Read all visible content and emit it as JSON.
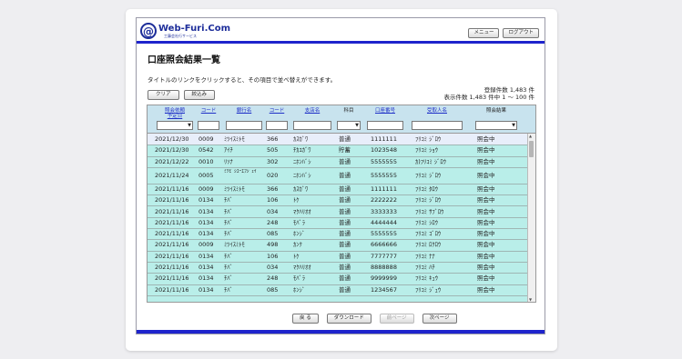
{
  "brand": {
    "at": "@",
    "name": "Web-Furi.Com",
    "tagline": "工藤会社行サービス"
  },
  "header": {
    "menu_label": "メニュー",
    "logout_label": "ログアウト"
  },
  "page_title": "口座照会結果一覧",
  "instruction": "タイトルのリンクをクリックすると、その項目で並べ替えができます。",
  "buttons": {
    "clear": "クリア",
    "filter": "絞込み"
  },
  "counts": {
    "registered": "登録件数  1,483 件",
    "displayed": "表示件数  1,483 件中 1 〜 100 件"
  },
  "columns": {
    "date_l1": "照会依頼",
    "date_l2": "予定日",
    "code1": "コード",
    "bank": "銀行名",
    "code2": "コード",
    "branch": "支店名",
    "type": "科目",
    "account": "口座番号",
    "name": "受取人名",
    "result": "照会結果"
  },
  "rows": [
    {
      "date": "2021/12/30",
      "bank_code": "0009",
      "bank": "ﾐﾂｲｽﾐﾄﾓ",
      "branch_code": "366",
      "branch": "ｶｽｶﾞﾜ",
      "type": "普通",
      "account": "1111111",
      "name": "ﾌﾘｺﾐ ｼﾞﾛｳ",
      "result": "照会中"
    },
    {
      "date": "2021/12/30",
      "bank_code": "0542",
      "bank": "ｱｲﾁ",
      "branch_code": "505",
      "branch": "ﾁｶﾕｶﾞﾜ",
      "type": "貯蓄",
      "account": "1023548",
      "name": "ﾌﾘｺﾐ ｼｮｳ",
      "result": "照会中"
    },
    {
      "date": "2021/12/22",
      "bank_code": "0010",
      "bank": "ﾘｿﾅ",
      "branch_code": "302",
      "branch": "ﾆﾎﾝﾊﾞｼ",
      "type": "普通",
      "account": "5555555",
      "name": "ｶ)ﾌﾘｺﾐ ｼﾞﾛｳ",
      "result": "照会中"
    },
    {
      "date": "2021/11/24",
      "bank_code": "0005",
      "bank": "ﾐﾂﾋﾞｼﾕｰｴﾌｼﾞｪｲ",
      "branch_code": "020",
      "branch": "ﾆﾎﾝﾊﾞｼ",
      "type": "普通",
      "account": "5555555",
      "name": "ﾌﾘｺﾐ ｼﾞﾛｳ",
      "result": "照会中"
    },
    {
      "date": "2021/11/16",
      "bank_code": "0009",
      "bank": "ﾐﾂｲｽﾐﾄﾓ",
      "branch_code": "366",
      "branch": "ｶｽｶﾞﾜ",
      "type": "普通",
      "account": "1111111",
      "name": "ﾌﾘｺﾐ ﾀﾛｳ",
      "result": "照会中"
    },
    {
      "date": "2021/11/16",
      "bank_code": "0134",
      "bank": "ﾁﾊﾞ",
      "branch_code": "106",
      "branch": "ﾄｹ",
      "type": "普通",
      "account": "2222222",
      "name": "ﾌﾘｺﾐ ｼﾞﾛｳ",
      "result": "照会中"
    },
    {
      "date": "2021/11/16",
      "bank_code": "0134",
      "bank": "ﾁﾊﾞ",
      "branch_code": "034",
      "branch": "ﾏｸﾊﾘｵｵ",
      "type": "普通",
      "account": "3333333",
      "name": "ﾌﾘｺﾐ ｻﾌﾞﾛｳ",
      "result": "照会中"
    },
    {
      "date": "2021/11/16",
      "bank_code": "0134",
      "bank": "ﾁﾊﾞ",
      "branch_code": "248",
      "branch": "ﾓﾊﾞﾗ",
      "type": "普通",
      "account": "4444444",
      "name": "ﾌﾘｺﾐ ｼﾛｳ",
      "result": "照会中"
    },
    {
      "date": "2021/11/16",
      "bank_code": "0134",
      "bank": "ﾁﾊﾞ",
      "branch_code": "085",
      "branch": "ﾎﾝｼﾞ",
      "type": "普通",
      "account": "5555555",
      "name": "ﾌﾘｺﾐ ｺﾞﾛｳ",
      "result": "照会中"
    },
    {
      "date": "2021/11/16",
      "bank_code": "0009",
      "bank": "ﾐﾂｲｽﾐﾄﾓ",
      "branch_code": "498",
      "branch": "ｶﾝｸ",
      "type": "普通",
      "account": "6666666",
      "name": "ﾌﾘｺﾐ ﾛｸﾛｳ",
      "result": "照会中"
    },
    {
      "date": "2021/11/16",
      "bank_code": "0134",
      "bank": "ﾁﾊﾞ",
      "branch_code": "106",
      "branch": "ﾄｹ",
      "type": "普通",
      "account": "7777777",
      "name": "ﾌﾘｺﾐ ﾅﾅ",
      "result": "照会中"
    },
    {
      "date": "2021/11/16",
      "bank_code": "0134",
      "bank": "ﾁﾊﾞ",
      "branch_code": "034",
      "branch": "ﾏｸﾊﾘｵｵ",
      "type": "普通",
      "account": "8888888",
      "name": "ﾌﾘｺﾐ ﾊﾁ",
      "result": "照会中"
    },
    {
      "date": "2021/11/16",
      "bank_code": "0134",
      "bank": "ﾁﾊﾞ",
      "branch_code": "248",
      "branch": "ﾓﾊﾞﾗ",
      "type": "普通",
      "account": "9999999",
      "name": "ﾌﾘｺﾐ ｷｭｳ",
      "result": "照会中"
    },
    {
      "date": "2021/11/16",
      "bank_code": "0134",
      "bank": "ﾁﾊﾞ",
      "branch_code": "085",
      "branch": "ﾎﾝｼﾞ",
      "type": "普通",
      "account": "1234567",
      "name": "ﾌﾘｺﾐ ｼﾞｭｳ",
      "result": "照会中"
    }
  ],
  "pager": {
    "back": "戻 る",
    "download": "ダウンロード",
    "prev": "前ページ",
    "next": "次ページ"
  },
  "colors": {
    "accent_bar": "#1e24cc",
    "row_bg": "#b9eee9",
    "link": "#1f2fc7"
  }
}
